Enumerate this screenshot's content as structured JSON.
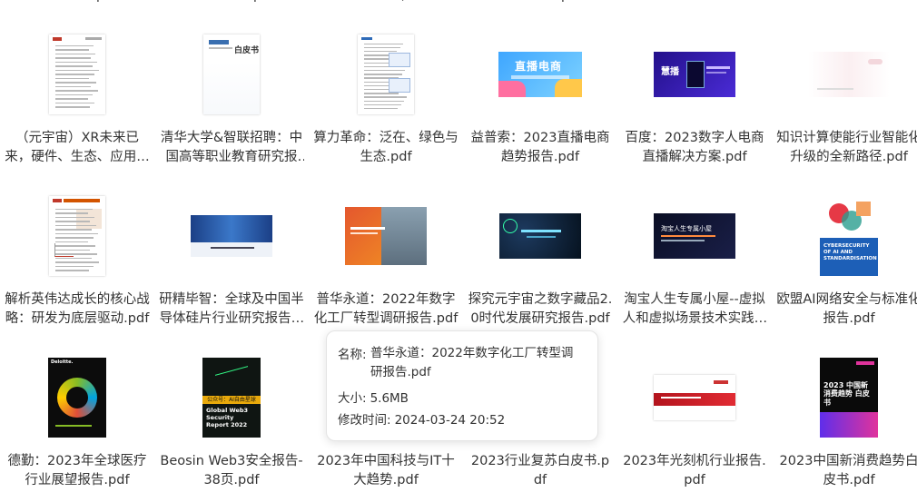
{
  "top_fragments": [
    "p",
    "p",
    "(",
    "p"
  ],
  "files": [
    {
      "name": "（元宇宙）XR未来已来，硬件、生态、应用等多维度解析.pdf",
      "thumb": "report-red",
      "thumb_name": "xr-report-thumbnail"
    },
    {
      "name": "清华大学&智联招聘：中国高等职业教育研究报告.pdf",
      "thumb": "whitepaper",
      "thumb_name": "whitepaper-thumbnail",
      "thumb_text": "白皮书"
    },
    {
      "name": "算力革命：泛在、绿色与生态.pdf",
      "thumb": "report-blue",
      "thumb_name": "compute-report-thumbnail"
    },
    {
      "name": "益普索：2023直播电商趋势报告.pdf",
      "thumb": "banner-live",
      "thumb_name": "live-commerce-thumbnail",
      "thumb_text": "直播电商"
    },
    {
      "name": "百度：2023数字人电商直播解决方案.pdf",
      "thumb": "banner-purple",
      "thumb_name": "digital-human-thumbnail",
      "thumb_text": "慧播"
    },
    {
      "name": "知识计算使能行业智能化升级的全新路径.pdf",
      "thumb": "light-fade",
      "thumb_name": "knowledge-compute-thumbnail"
    },
    {
      "name": "解析英伟达成长的核心战略：研发为底层驱动.pdf",
      "thumb": "report-red2",
      "thumb_name": "nvidia-report-thumbnail"
    },
    {
      "name": "研精毕智：全球及中国半导体硅片行业研究报告.pdf",
      "thumb": "banner-blue",
      "thumb_name": "semiconductor-thumbnail"
    },
    {
      "name": "普华永道：2022年数字化工厂转型调研报告.pdf",
      "thumb": "factory",
      "thumb_name": "factory-report-thumbnail"
    },
    {
      "name": "探究元宇宙之数字藏品2.0时代发展研究报告.pdf",
      "thumb": "banner-dark",
      "thumb_name": "digital-collectibles-thumbnail"
    },
    {
      "name": "淘宝人生专属小屋--虚拟人和虚拟场景技术实践.pdf",
      "thumb": "banner-black",
      "thumb_name": "taobao-virtual-thumbnail",
      "thumb_text": "淘宝人生专属小屋"
    },
    {
      "name": "欧盟AI网络安全与标准化报告.pdf",
      "thumb": "eu-cyber",
      "thumb_name": "eu-cybersecurity-thumbnail",
      "thumb_text": "CYBERSECURITY OF AI AND STANDARDISATION"
    },
    {
      "name": "德勤：2023年全球医疗行业展望报告.pdf",
      "thumb": "deloitte",
      "thumb_name": "deloitte-health-thumbnail",
      "thumb_text": "Deloitte."
    },
    {
      "name": "Beosin Web3安全报告-38页.pdf",
      "thumb": "web3",
      "thumb_name": "web3-security-thumbnail",
      "thumb_text": "Global Web3 Security Report 2022",
      "thumb_tag": "公众号：AI自由星球"
    },
    {
      "name": "2023年中国科技与IT十大趋势.pdf",
      "thumb": "none",
      "thumb_name": "it-trends-thumbnail"
    },
    {
      "name": "2023行业复苏白皮书.pdf",
      "thumb": "none",
      "thumb_name": "recovery-whitepaper-thumbnail"
    },
    {
      "name": "2023年光刻机行业报告.pdf",
      "thumb": "lithography",
      "thumb_name": "lithography-thumbnail"
    },
    {
      "name": "2023中国新消费趋势白皮书.pdf",
      "thumb": "consumer",
      "thumb_name": "consumer-trends-thumbnail",
      "thumb_text": "2023 中国新消费趋势 白皮书"
    }
  ],
  "tooltip": {
    "name_label": "名称:",
    "name_value": "普华永道：2022年数字化工厂转型调研报告.pdf",
    "size_label": "大小:",
    "size_value": "5.6MB",
    "modified_label": "修改时间:",
    "modified_value": "2024-03-24 20:52"
  }
}
